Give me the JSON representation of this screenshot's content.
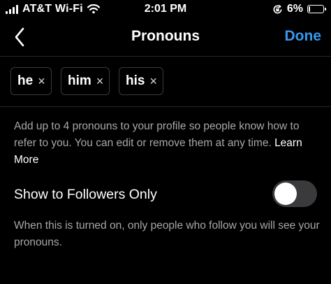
{
  "status_bar": {
    "carrier": "AT&T Wi-Fi",
    "time": "2:01 PM",
    "battery_percent": "6%",
    "battery_level": 0.06
  },
  "header": {
    "title": "Pronouns",
    "done_label": "Done"
  },
  "pronouns": {
    "items": [
      {
        "label": "he",
        "remove": "×"
      },
      {
        "label": "him",
        "remove": "×"
      },
      {
        "label": "his",
        "remove": "×"
      }
    ]
  },
  "info": {
    "text": "Add up to 4 pronouns to your profile so people know how to refer to you. You can edit or remove them at any time. ",
    "learn_more": "Learn More"
  },
  "followers_toggle": {
    "label": "Show to Followers Only",
    "enabled": false,
    "caption": "When this is turned on, only people who follow you will see your pronouns."
  },
  "colors": {
    "background": "#000000",
    "accent": "#3797f0",
    "secondary_text": "#a8a8a8",
    "divider": "#262626"
  }
}
